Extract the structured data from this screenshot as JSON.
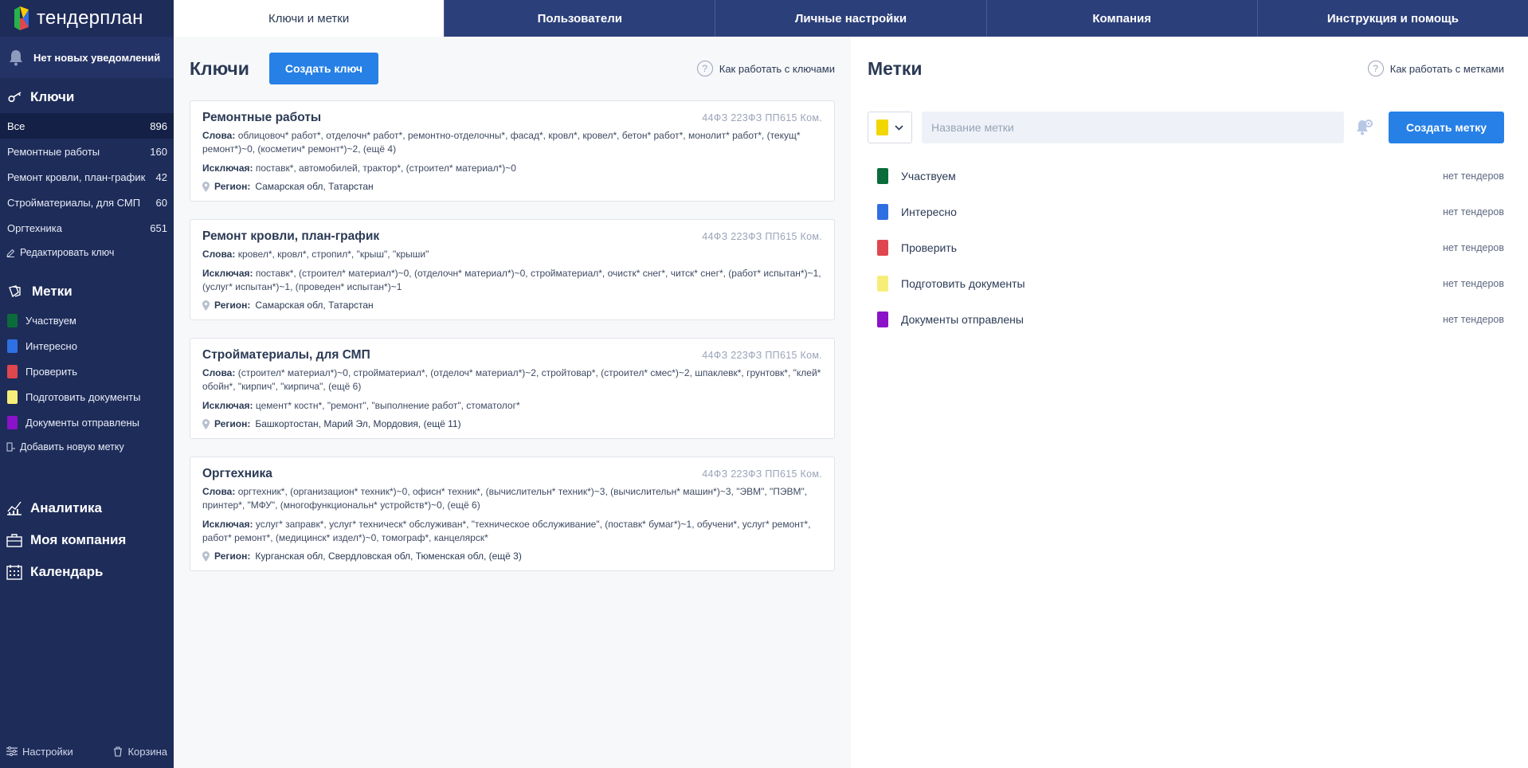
{
  "brand": {
    "name": "тендерплан"
  },
  "notifications": {
    "text": "Нет новых уведомлений"
  },
  "sidebar": {
    "keys_heading": "Ключи",
    "key_items": [
      {
        "label": "Все",
        "count": "896"
      },
      {
        "label": "Ремонтные работы",
        "count": "160"
      },
      {
        "label": "Ремонт кровли, план-график",
        "count": "42"
      },
      {
        "label": "Стройматериалы, для СМП",
        "count": "60"
      },
      {
        "label": "Оргтехника",
        "count": "651"
      }
    ],
    "edit_key": "Редактировать ключ",
    "tags_heading": "Метки",
    "tag_items": [
      {
        "label": "Участвуем",
        "color": "#0b6b3a"
      },
      {
        "label": "Интересно",
        "color": "#2f6fe4"
      },
      {
        "label": "Проверить",
        "color": "#e0464e"
      },
      {
        "label": "Подготовить документы",
        "color": "#f7ee7a"
      },
      {
        "label": "Документы отправлены",
        "color": "#8a12c9"
      }
    ],
    "add_tag": "Добавить новую метку",
    "nav": {
      "analytics": "Аналитика",
      "company": "Моя компания",
      "calendar": "Календарь"
    },
    "settings": "Настройки",
    "trash": "Корзина"
  },
  "topnav": {
    "tabs": [
      "Ключи и метки",
      "Пользователи",
      "Личные настройки",
      "Компания",
      "Инструкция и помощь"
    ]
  },
  "keys": {
    "title": "Ключи",
    "create_button": "Создать ключ",
    "help": "Как работать с ключами",
    "cards": [
      {
        "title": "Ремонтные работы",
        "laws": "44ФЗ 223ФЗ ПП615 Ком.",
        "words_label": "Слова:",
        "words": "облицовоч* работ*, отделочн* работ*, ремонтно-отделочны*, фасад*, кровл*, кровел*, бетон* работ*, монолит* работ*, (текущ* ремонт*)~0, (косметич* ремонт*)~2, (ещё 4)",
        "exclude_label": "Исключая:",
        "exclude": "поставк*, автомобилей, трактор*, (строител* материал*)~0",
        "region_label": "Регион:",
        "region": "Самарская обл,  Татарстан"
      },
      {
        "title": "Ремонт кровли, план-график",
        "laws": "44ФЗ 223ФЗ ПП615 Ком.",
        "words_label": "Слова:",
        "words": "кровел*, кровл*, стропил*, \"крыш\", \"крыши\"",
        "exclude_label": "Исключая:",
        "exclude": "поставк*, (строител* материал*)~0, (отделочн* материал*)~0, стройматериал*, очистк* снег*, читск* снег*, (работ* испытан*)~1, (услуг* испытан*)~1, (проведен* испытан*)~1",
        "region_label": "Регион:",
        "region": "Самарская обл,  Татарстан"
      },
      {
        "title": "Стройматериалы, для СМП",
        "laws": "44ФЗ 223ФЗ ПП615 Ком.",
        "words_label": "Слова:",
        "words": "(строител* материал*)~0, стройматериал*, (отделоч* материал*)~2, стройтовар*, (строител* смес*)~2, шпаклевк*, грунтовк*, \"клей* обойн*, \"кирпич\", \"кирпича\", (ещё 6)",
        "exclude_label": "Исключая:",
        "exclude": "цемент* костн*, \"ремонт\", \"выполнение работ\", стоматолог*",
        "region_label": "Регион:",
        "region": "Башкортостан,  Марий Эл,  Мордовия,  (ещё 11)"
      },
      {
        "title": "Оргтехника",
        "laws": "44ФЗ 223ФЗ ПП615 Ком.",
        "words_label": "Слова:",
        "words": "оргтехник*, (организацион* техник*)~0, офисн* техник*, (вычислительн* техник*)~3, (вычислительн* машин*)~3, \"ЭВМ\", \"ПЭВМ\", принтер*, \"МФУ\", (многофункциональн* устройств*)~0, (ещё 6)",
        "exclude_label": "Исключая:",
        "exclude": "услуг* заправк*, услуг* техническ* обслуживан*, \"техническое обслуживание\", (поставк* бумаг*)~1, обучени*, услуг* ремонт*, работ* ремонт*, (медицинск* издел*)~0, томограф*, канцелярск*",
        "region_label": "Регион:",
        "region": "Курганская обл,  Свердловская обл,  Тюменская обл,  (ещё 3)"
      }
    ]
  },
  "tags": {
    "title": "Метки",
    "help": "Как работать с метками",
    "input_placeholder": "Название метки",
    "selected_color": "#f2d600",
    "create_button": "Создать метку",
    "rows": [
      {
        "label": "Участвуем",
        "color": "#0b6b3a",
        "count": "нет тендеров"
      },
      {
        "label": "Интересно",
        "color": "#2f6fe4",
        "count": "нет тендеров"
      },
      {
        "label": "Проверить",
        "color": "#e0464e",
        "count": "нет тендеров"
      },
      {
        "label": "Подготовить документы",
        "color": "#f7ee7a",
        "count": "нет тендеров"
      },
      {
        "label": "Документы отправлены",
        "color": "#8a12c9",
        "count": "нет тендеров"
      }
    ]
  }
}
